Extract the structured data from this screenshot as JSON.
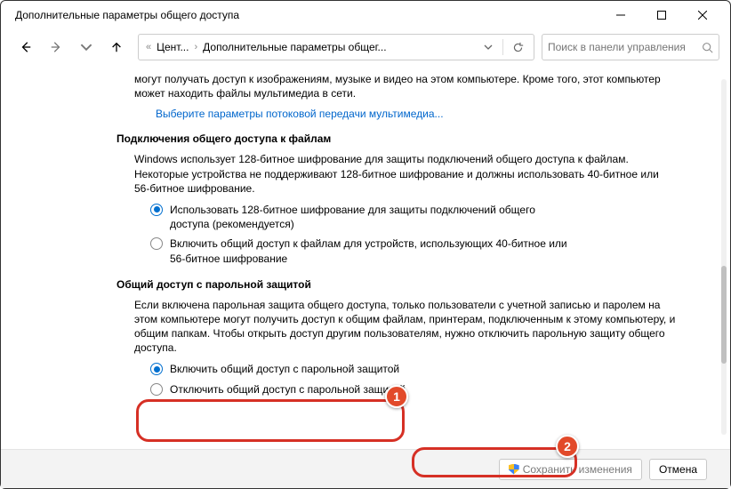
{
  "window": {
    "title": "Дополнительные параметры общего доступа"
  },
  "breadcrumb": {
    "prefix": "«",
    "item1": "Цент...",
    "item2": "Дополнительные параметры общег..."
  },
  "search": {
    "placeholder": "Поиск в панели управления"
  },
  "media": {
    "para": "могут получать доступ к изображениям, музыке и видео на этом компьютере. Кроме того, этот компьютер может находить файлы мультимедиа в сети.",
    "link": "Выберите параметры потоковой передачи мультимедиа..."
  },
  "encryption": {
    "title": "Подключения общего доступа к файлам",
    "para": "Windows использует 128-битное шифрование для защиты подключений общего доступа к файлам. Некоторые устройства не поддерживают 128-битное шифрование и должны использовать 40-битное или 56-битное шифрование.",
    "opt1": "Использовать 128-битное шифрование для защиты подключений общего доступа (рекомендуется)",
    "opt2": "Включить общий доступ к файлам для устройств, использующих 40-битное или 56-битное шифрование"
  },
  "password": {
    "title": "Общий доступ с парольной защитой",
    "para": "Если включена парольная защита общего доступа, только пользователи с учетной записью и паролем на этом компьютере могут получить доступ к общим файлам, принтерам, подключенным к этому компьютеру, и общим папкам. Чтобы открыть доступ другим пользователям, нужно отключить парольную защиту общего доступа.",
    "opt1": "Включить общий доступ с парольной защитой",
    "opt2": "Отключить общий доступ с парольной защитой"
  },
  "footer": {
    "save": "Сохранить изменения",
    "cancel": "Отмена"
  },
  "badges": {
    "one": "1",
    "two": "2"
  }
}
